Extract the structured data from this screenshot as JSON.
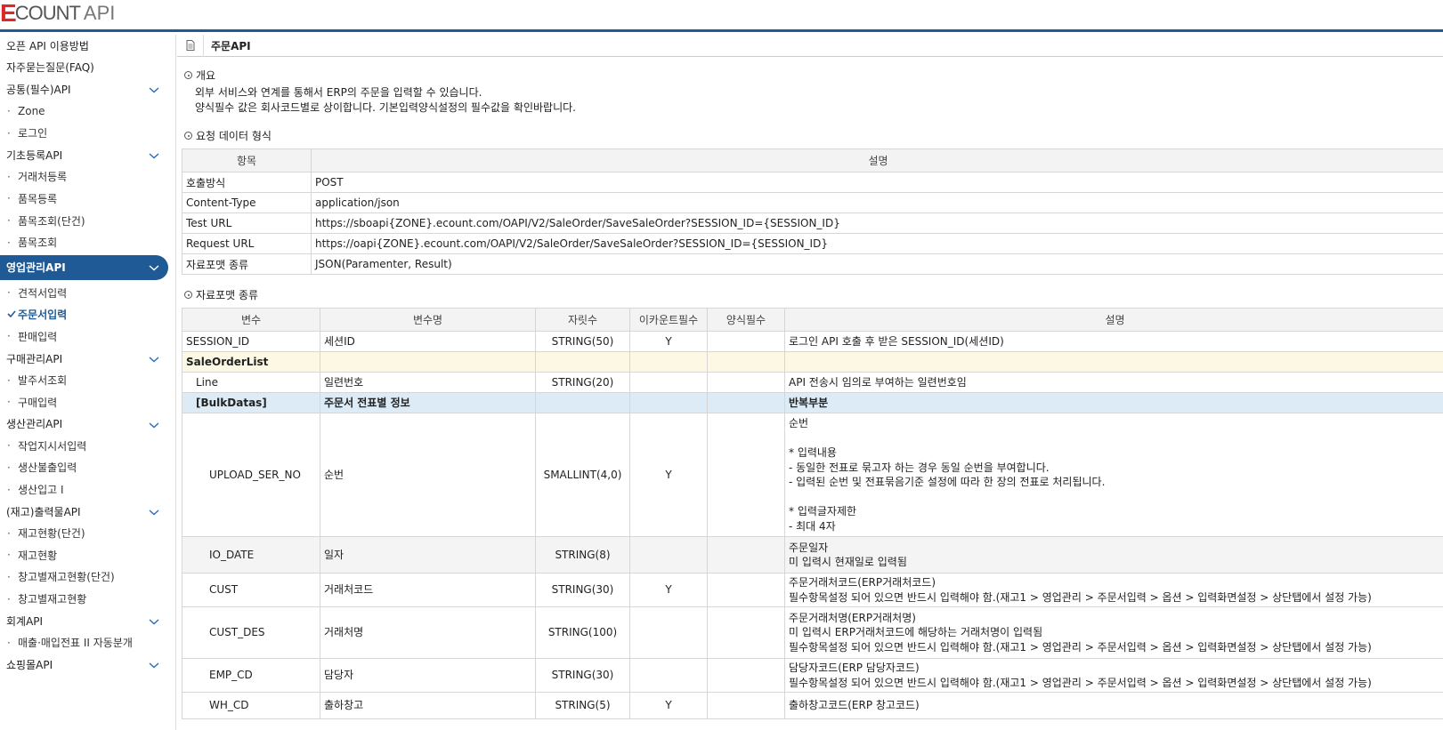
{
  "logo": {
    "e": "E",
    "count": "COUNT",
    "api": "API"
  },
  "sidebar": [
    {
      "type": "cat",
      "label": "오픈 API 이용방법"
    },
    {
      "type": "cat",
      "label": "자주묻는질문(FAQ)"
    },
    {
      "type": "cat",
      "label": "공통(필수)API",
      "chevron": true
    },
    {
      "type": "sub",
      "label": "Zone"
    },
    {
      "type": "sub",
      "label": "로그인"
    },
    {
      "type": "cat",
      "label": "기초등록API",
      "chevron": true
    },
    {
      "type": "sub",
      "label": "거래처등록"
    },
    {
      "type": "sub",
      "label": "품목등록"
    },
    {
      "type": "sub",
      "label": "품목조회(단건)"
    },
    {
      "type": "sub",
      "label": "품목조회"
    },
    {
      "type": "cat-active",
      "label": "영업관리API",
      "chevron": true
    },
    {
      "type": "sub",
      "label": "견적서입력"
    },
    {
      "type": "sub-active",
      "label": "주문서입력"
    },
    {
      "type": "sub",
      "label": "판매입력"
    },
    {
      "type": "cat",
      "label": "구매관리API",
      "chevron": true
    },
    {
      "type": "sub",
      "label": "발주서조회"
    },
    {
      "type": "sub",
      "label": "구매입력"
    },
    {
      "type": "cat",
      "label": "생산관리API",
      "chevron": true
    },
    {
      "type": "sub",
      "label": "작업지시서입력"
    },
    {
      "type": "sub",
      "label": "생산불출입력"
    },
    {
      "type": "sub",
      "label": "생산입고 I"
    },
    {
      "type": "cat",
      "label": "(재고)출력물API",
      "chevron": true
    },
    {
      "type": "sub",
      "label": "재고현황(단건)"
    },
    {
      "type": "sub",
      "label": "재고현황"
    },
    {
      "type": "sub",
      "label": "창고별재고현황(단건)"
    },
    {
      "type": "sub",
      "label": "창고별재고현황"
    },
    {
      "type": "cat",
      "label": "회계API",
      "chevron": true
    },
    {
      "type": "sub",
      "label": "매출·매입전표 II 자동분개"
    },
    {
      "type": "cat",
      "label": "쇼핑몰API",
      "chevron": true
    }
  ],
  "page": {
    "title": "주문API",
    "overview_title": "개요",
    "overview_lines": [
      "외부 서비스와 연계를 통해서 ERP의 주문을 입력할 수 있습니다.",
      "양식필수 값은 회사코드별로 상이합니다. 기본입력양식설정의 필수값을 확인바랍니다."
    ],
    "request_title": "요청 데이터 형식",
    "request_headers": [
      "항목",
      "설명"
    ],
    "request_rows": [
      [
        "호출방식",
        "POST"
      ],
      [
        "Content-Type",
        "application/json"
      ],
      [
        "Test URL",
        "https://sboapi{ZONE}.ecount.com/OAPI/V2/SaleOrder/SaveSaleOrder?SESSION_ID={SESSION_ID}"
      ],
      [
        "Request URL",
        "https://oapi{ZONE}.ecount.com/OAPI/V2/SaleOrder/SaveSaleOrder?SESSION_ID={SESSION_ID}"
      ],
      [
        "자료포맷 종류",
        "JSON(Paramenter, Result)"
      ]
    ],
    "format_title": "자료포맷 종류",
    "format_headers": [
      "변수",
      "변수명",
      "자릿수",
      "이카운트필수",
      "양식필수",
      "설명"
    ],
    "format_rows": [
      {
        "style": "",
        "indent": 0,
        "cells": [
          "SESSION_ID",
          "세션ID",
          "STRING(50)",
          "Y",
          "",
          "로그인 API 호출 후 받은 SESSION_ID(세션ID)"
        ],
        "h": 23
      },
      {
        "style": "yellow",
        "indent": 0,
        "cells": [
          "SaleOrderList",
          "",
          "",
          "",
          "",
          ""
        ],
        "h": 23
      },
      {
        "style": "",
        "indent": 1,
        "cells": [
          "Line",
          "일련번호",
          "STRING(20)",
          "",
          "",
          "API 전송시 임의로 부여하는 일련번호임"
        ],
        "h": 23
      },
      {
        "style": "blue",
        "indent": 1,
        "cells": [
          "[BulkDatas]",
          "주문서 전표별 정보",
          "",
          "",
          "",
          "반복부분"
        ],
        "h": 23
      },
      {
        "style": "",
        "indent": 2,
        "cells": [
          "UPLOAD_SER_NO",
          "순번",
          "SMALLINT(4,0)",
          "Y",
          "",
          "순번\n\n* 입력내용\n- 동일한 전표로 묶고자 하는 경우 동일 순번을 부여합니다.\n- 입력된 순번 및 전표묶음기준 설정에 따라 한 장의 전표로 처리됩니다.\n\n* 입력글자제한\n- 최대 4자"
        ],
        "h": 139
      },
      {
        "style": "gray",
        "indent": 2,
        "cells": [
          "IO_DATE",
          "일자",
          "STRING(8)",
          "",
          "",
          "주문일자\n미 입력시 현재일로 입력됨"
        ],
        "h": 41
      },
      {
        "style": "",
        "indent": 2,
        "cells": [
          "CUST",
          "거래처코드",
          "STRING(30)",
          "Y",
          "",
          "주문거래처코드(ERP거래처코드)\n필수항목설정 되어 있으면 반드시 입력해야 함.(재고1 > 영업관리 > 주문서입력 > 옵션 > 입력화면설정 > 상단탭에서 설정 가능)"
        ],
        "h": 38
      },
      {
        "style": "",
        "indent": 2,
        "cells": [
          "CUST_DES",
          "거래처명",
          "STRING(100)",
          "",
          "",
          "주문거래처명(ERP거래처명)\n미 입력시 ERP거래처코드에 해당하는 거래처명이 입력됨\n필수항목설정 되어 있으면 반드시 입력해야 함.(재고1 > 영업관리 > 주문서입력 > 옵션 > 입력화면설정 > 상단탭에서 설정 가능)"
        ],
        "h": 58
      },
      {
        "style": "",
        "indent": 2,
        "cells": [
          "EMP_CD",
          "담당자",
          "STRING(30)",
          "",
          "",
          "담당자코드(ERP 담당자코드)\n필수항목설정 되어 있으면 반드시 입력해야 함.(재고1 > 영업관리 > 주문서입력 > 옵션 > 입력화면설정 > 상단탭에서 설정 가능)"
        ],
        "h": 38
      },
      {
        "style": "",
        "indent": 2,
        "cells": [
          "WH_CD",
          "출하창고",
          "STRING(5)",
          "Y",
          "",
          "출하창고코드(ERP 창고코드)"
        ],
        "h": 30
      }
    ]
  }
}
